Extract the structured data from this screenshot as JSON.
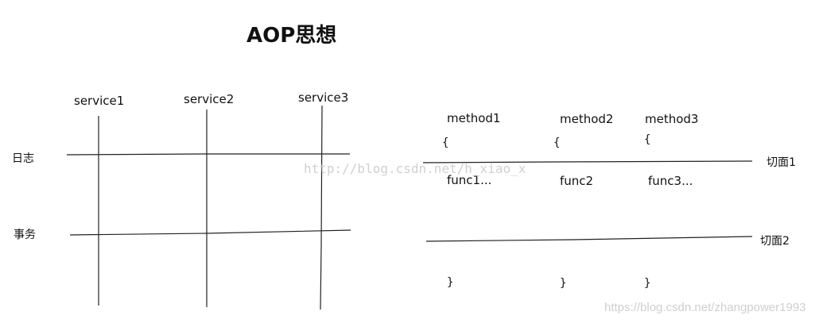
{
  "title": "AOP思想",
  "left_grid": {
    "services": [
      "service1",
      "service2",
      "service3"
    ],
    "rows": [
      "日志",
      "事务"
    ]
  },
  "right_diagram": {
    "methods": [
      "method1",
      "method2",
      "method3"
    ],
    "open_brace": "{",
    "close_brace": "}",
    "funcs": [
      "func1...",
      "func2",
      "func3..."
    ],
    "aspects": [
      "切面1",
      "切面2"
    ]
  },
  "watermarks": {
    "center": "http://blog.csdn.net/h_xiao_x",
    "bottom_right": "https://blog.csdn.net/zhangpower1993"
  },
  "colors": {
    "line": "#222222",
    "watermark": "#d0d0d0"
  }
}
